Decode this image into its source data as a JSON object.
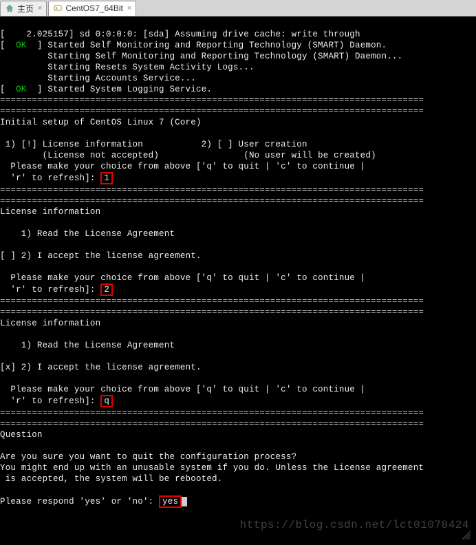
{
  "tabs": {
    "home_label": "主页",
    "vm_label": "CentOS7_64Bit"
  },
  "boot": {
    "l1": "[    2.025157] sd 0:0:0:0: [sda] Assuming drive cache: write through",
    "l2a": "[  ",
    "l2ok": "OK",
    "l2b": "  ] Started Self Monitoring and Reporting Technology (SMART) Daemon.",
    "l3": "         Starting Self Monitoring and Reporting Technology (SMART) Daemon...",
    "l4": "         Starting Resets System Activity Logs...",
    "l5": "         Starting Accounts Service...",
    "l6a": "[  ",
    "l6ok": "OK",
    "l6b": "  ] Started System Logging Service."
  },
  "divider": "================================================================================",
  "initial": {
    "title": "Initial setup of CentOS Linux 7 (Core)",
    "opt1_line": " 1) [!] License information           2) [ ] User creation",
    "sub_line": "        (License not accepted)                (No user will be created)",
    "prompt1": "  Please make your choice from above ['q' to quit | 'c' to continue |",
    "prompt2a": "  'r' to refresh]: ",
    "input1": "1"
  },
  "license1": {
    "title": "License information",
    "read": "    1) Read the License Agreement",
    "accept": "[ ] 2) I accept the license agreement.",
    "prompt1": "  Please make your choice from above ['q' to quit | 'c' to continue |",
    "prompt2a": "  'r' to refresh]: ",
    "input": "2"
  },
  "license2": {
    "title": "License information",
    "read": "    1) Read the License Agreement",
    "accept": "[x] 2) I accept the license agreement.",
    "prompt1": "  Please make your choice from above ['q' to quit | 'c' to continue |",
    "prompt2a": "  'r' to refresh]: ",
    "input": "q"
  },
  "question": {
    "title": "Question",
    "l1": "Are you sure you want to quit the configuration process?",
    "l2": "You might end up with an unusable system if you do. Unless the License agreement",
    "l3": " is accepted, the system will be rebooted.",
    "prompt": "Please respond 'yes' or 'no': ",
    "input": "yes"
  },
  "watermark": "https://blog.csdn.net/lct01078424"
}
